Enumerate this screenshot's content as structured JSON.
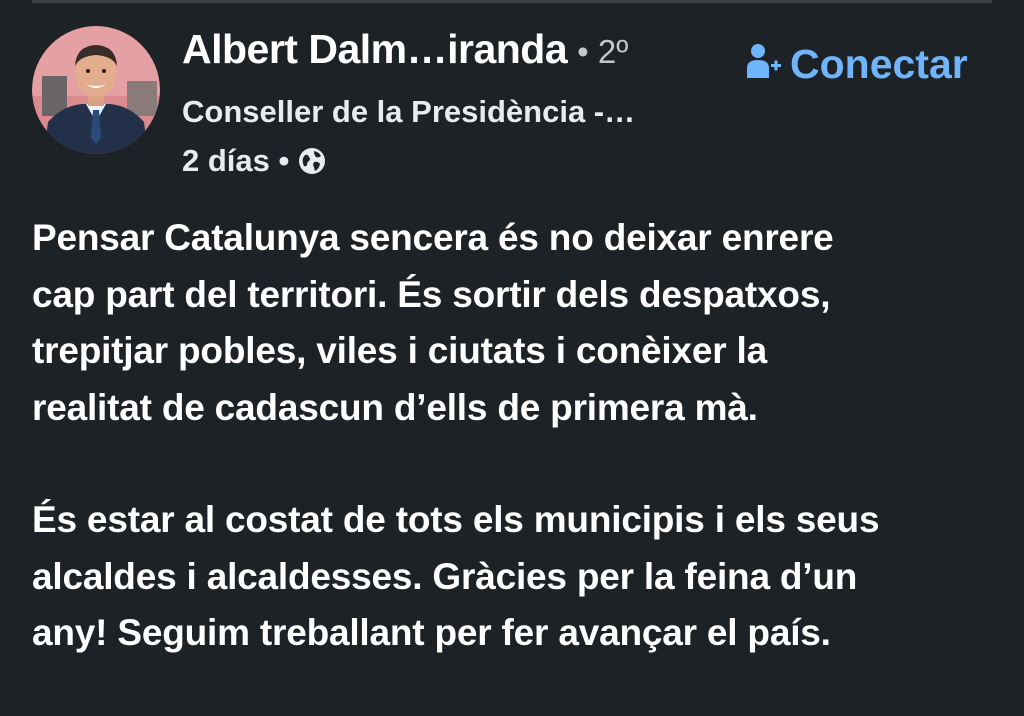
{
  "post": {
    "author": {
      "name": "Albert Dalm…iranda",
      "connection_degree": "• 2º",
      "title": "Conseller de la Presidència -…",
      "avatar_icon": "avatar-photo"
    },
    "meta": {
      "age": "2 días •",
      "visibility_icon": "globe-icon"
    },
    "connect": {
      "icon": "person-add-icon",
      "label": "Conectar"
    },
    "paragraphs": [
      "Pensar Catalunya sencera és no deixar enrere\ncap part del territori. És sortir dels despatxos,\ntrepitjar pobles, viles i ciutats i conèixer la\nrealitat de cadascun d’ells de primera mà.",
      "És estar al costat de tots els municipis i els seus\nalcaldes i alcaldesses. Gràcies per la feina d’un\nany! Seguim treballant per fer avançar el país."
    ]
  },
  "colors": {
    "background": "#1d2226",
    "text_primary": "#ffffff",
    "text_secondary": "#c3c7cb",
    "accent": "#70b5f9"
  }
}
